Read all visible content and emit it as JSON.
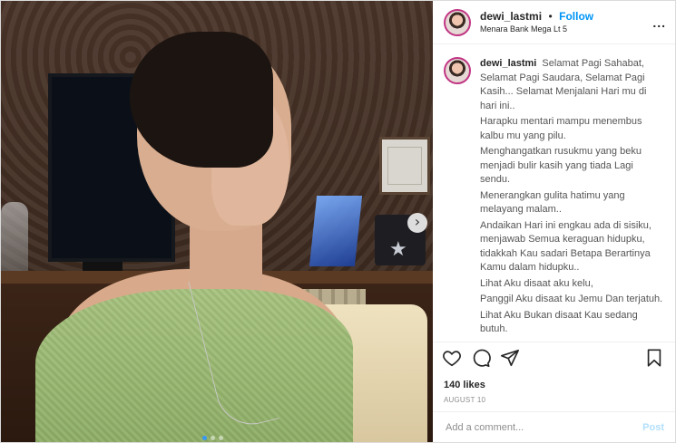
{
  "post": {
    "header": {
      "username": "dewi_lastmi",
      "separator": "•",
      "follow_label": "Follow",
      "location": "Menara Bank Mega Lt 5",
      "more_label": "..."
    },
    "caption": {
      "username": "dewi_lastmi",
      "lines": [
        "Selamat Pagi Sahabat, Selamat Pagi Saudara, Selamat Pagi Kasih... Selamat Menjalani Hari mu di hari ini..",
        "Harapku mentari mampu menembus kalbu mu yang pilu.",
        "Menghangatkan rusukmu yang beku menjadi bulir kasih yang tiada Lagi sendu.",
        "Menerangkan gulita hatimu yang melayang malam..",
        "Andaikan Hari ini engkau ada di sisiku, menjawab Semua keraguan hidupku, tidakkah Kau sadari Betapa Berartinya Kamu dalam hidupku..",
        "Lihat Aku disaat aku kelu,",
        "Panggil Aku disaat ku Jemu Dan terjatuh.",
        "Lihat Aku Bukan disaat Kau sedang butuh."
      ]
    },
    "actions": {
      "like_icon": "heart-icon",
      "comment_icon": "comment-icon",
      "share_icon": "send-icon",
      "save_icon": "bookmark-icon"
    },
    "likes": "140 likes",
    "date": "AUGUST 10",
    "comment_box": {
      "placeholder": "Add a comment...",
      "post_label": "Post"
    },
    "carousel": {
      "next_icon": "chevron-right-icon",
      "next_glyph": "›"
    }
  },
  "colors": {
    "link_blue": "#0095f6",
    "post_disabled": "#b2dffc",
    "text_primary": "#262626",
    "text_secondary": "#8e8e8e"
  }
}
